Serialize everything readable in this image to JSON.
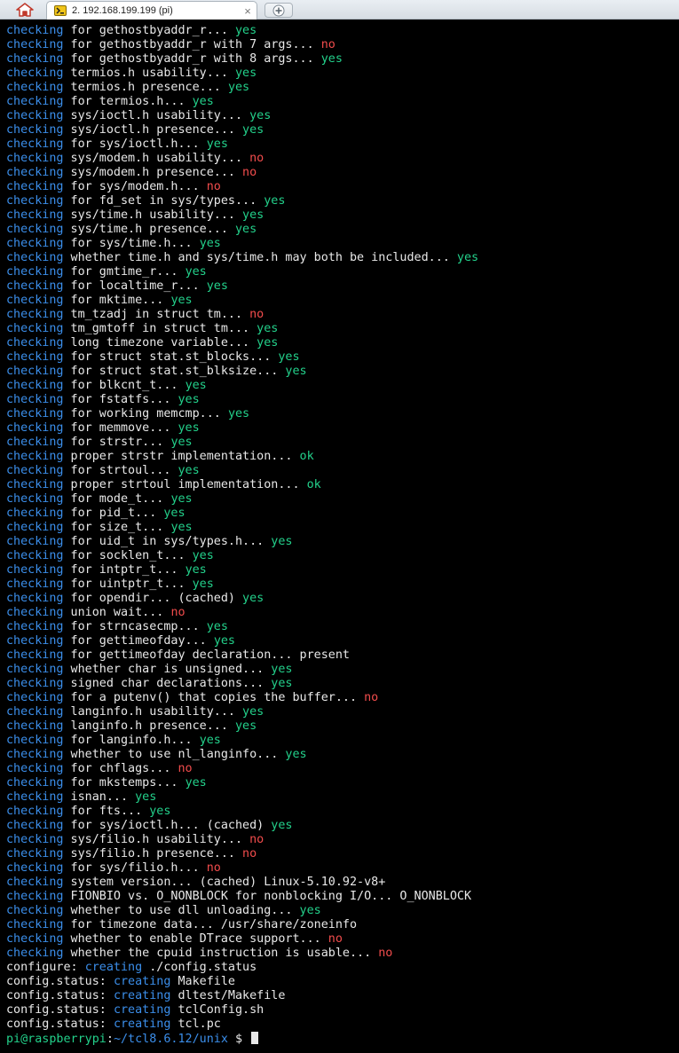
{
  "tab": {
    "title": "2. 192.168.199.199 (pi)",
    "close_label": "×"
  },
  "colors": {
    "keyword": "#3b8eea",
    "yes": "#23d18b",
    "no": "#f14c4c",
    "text": "#e8e8e8",
    "background": "#000000"
  },
  "terminal": {
    "lines": [
      {
        "kw": "checking",
        "text": " for gethostbyaddr_r... ",
        "result": "yes",
        "rtype": "yes"
      },
      {
        "kw": "checking",
        "text": " for gethostbyaddr_r with 7 args... ",
        "result": "no",
        "rtype": "no"
      },
      {
        "kw": "checking",
        "text": " for gethostbyaddr_r with 8 args... ",
        "result": "yes",
        "rtype": "yes"
      },
      {
        "kw": "checking",
        "text": " termios.h usability... ",
        "result": "yes",
        "rtype": "yes"
      },
      {
        "kw": "checking",
        "text": " termios.h presence... ",
        "result": "yes",
        "rtype": "yes"
      },
      {
        "kw": "checking",
        "text": " for termios.h... ",
        "result": "yes",
        "rtype": "yes"
      },
      {
        "kw": "checking",
        "text": " sys/ioctl.h usability... ",
        "result": "yes",
        "rtype": "yes"
      },
      {
        "kw": "checking",
        "text": " sys/ioctl.h presence... ",
        "result": "yes",
        "rtype": "yes"
      },
      {
        "kw": "checking",
        "text": " for sys/ioctl.h... ",
        "result": "yes",
        "rtype": "yes"
      },
      {
        "kw": "checking",
        "text": " sys/modem.h usability... ",
        "result": "no",
        "rtype": "no"
      },
      {
        "kw": "checking",
        "text": " sys/modem.h presence... ",
        "result": "no",
        "rtype": "no"
      },
      {
        "kw": "checking",
        "text": " for sys/modem.h... ",
        "result": "no",
        "rtype": "no"
      },
      {
        "kw": "checking",
        "text": " for fd_set in sys/types... ",
        "result": "yes",
        "rtype": "yes"
      },
      {
        "kw": "checking",
        "text": " sys/time.h usability... ",
        "result": "yes",
        "rtype": "yes"
      },
      {
        "kw": "checking",
        "text": " sys/time.h presence... ",
        "result": "yes",
        "rtype": "yes"
      },
      {
        "kw": "checking",
        "text": " for sys/time.h... ",
        "result": "yes",
        "rtype": "yes"
      },
      {
        "kw": "checking",
        "text": " whether time.h and sys/time.h may both be included... ",
        "result": "yes",
        "rtype": "yes"
      },
      {
        "kw": "checking",
        "text": " for gmtime_r... ",
        "result": "yes",
        "rtype": "yes"
      },
      {
        "kw": "checking",
        "text": " for localtime_r... ",
        "result": "yes",
        "rtype": "yes"
      },
      {
        "kw": "checking",
        "text": " for mktime... ",
        "result": "yes",
        "rtype": "yes"
      },
      {
        "kw": "checking",
        "text": " tm_tzadj in struct tm... ",
        "result": "no",
        "rtype": "no"
      },
      {
        "kw": "checking",
        "text": " tm_gmtoff in struct tm... ",
        "result": "yes",
        "rtype": "yes"
      },
      {
        "kw": "checking",
        "text": " long timezone variable... ",
        "result": "yes",
        "rtype": "yes"
      },
      {
        "kw": "checking",
        "text": " for struct stat.st_blocks... ",
        "result": "yes",
        "rtype": "yes"
      },
      {
        "kw": "checking",
        "text": " for struct stat.st_blksize... ",
        "result": "yes",
        "rtype": "yes"
      },
      {
        "kw": "checking",
        "text": " for blkcnt_t... ",
        "result": "yes",
        "rtype": "yes"
      },
      {
        "kw": "checking",
        "text": " for fstatfs... ",
        "result": "yes",
        "rtype": "yes"
      },
      {
        "kw": "checking",
        "text": " for working memcmp... ",
        "result": "yes",
        "rtype": "yes"
      },
      {
        "kw": "checking",
        "text": " for memmove... ",
        "result": "yes",
        "rtype": "yes"
      },
      {
        "kw": "checking",
        "text": " for strstr... ",
        "result": "yes",
        "rtype": "yes"
      },
      {
        "kw": "checking",
        "text": " proper strstr implementation... ",
        "result": "ok",
        "rtype": "ok"
      },
      {
        "kw": "checking",
        "text": " for strtoul... ",
        "result": "yes",
        "rtype": "yes"
      },
      {
        "kw": "checking",
        "text": " proper strtoul implementation... ",
        "result": "ok",
        "rtype": "ok"
      },
      {
        "kw": "checking",
        "text": " for mode_t... ",
        "result": "yes",
        "rtype": "yes"
      },
      {
        "kw": "checking",
        "text": " for pid_t... ",
        "result": "yes",
        "rtype": "yes"
      },
      {
        "kw": "checking",
        "text": " for size_t... ",
        "result": "yes",
        "rtype": "yes"
      },
      {
        "kw": "checking",
        "text": " for uid_t in sys/types.h... ",
        "result": "yes",
        "rtype": "yes"
      },
      {
        "kw": "checking",
        "text": " for socklen_t... ",
        "result": "yes",
        "rtype": "yes"
      },
      {
        "kw": "checking",
        "text": " for intptr_t... ",
        "result": "yes",
        "rtype": "yes"
      },
      {
        "kw": "checking",
        "text": " for uintptr_t... ",
        "result": "yes",
        "rtype": "yes"
      },
      {
        "kw": "checking",
        "text": " for opendir... (cached) ",
        "result": "yes",
        "rtype": "yes"
      },
      {
        "kw": "checking",
        "text": " union wait... ",
        "result": "no",
        "rtype": "no"
      },
      {
        "kw": "checking",
        "text": " for strncasecmp... ",
        "result": "yes",
        "rtype": "yes"
      },
      {
        "kw": "checking",
        "text": " for gettimeofday... ",
        "result": "yes",
        "rtype": "yes"
      },
      {
        "kw": "checking",
        "text": " for gettimeofday declaration... present",
        "result": "",
        "rtype": "plain"
      },
      {
        "kw": "checking",
        "text": " whether char is unsigned... ",
        "result": "yes",
        "rtype": "yes"
      },
      {
        "kw": "checking",
        "text": " signed char declarations... ",
        "result": "yes",
        "rtype": "yes"
      },
      {
        "kw": "checking",
        "text": " for a putenv() that copies the buffer... ",
        "result": "no",
        "rtype": "no"
      },
      {
        "kw": "checking",
        "text": " langinfo.h usability... ",
        "result": "yes",
        "rtype": "yes"
      },
      {
        "kw": "checking",
        "text": " langinfo.h presence... ",
        "result": "yes",
        "rtype": "yes"
      },
      {
        "kw": "checking",
        "text": " for langinfo.h... ",
        "result": "yes",
        "rtype": "yes"
      },
      {
        "kw": "checking",
        "text": " whether to use nl_langinfo... ",
        "result": "yes",
        "rtype": "yes"
      },
      {
        "kw": "checking",
        "text": " for chflags... ",
        "result": "no",
        "rtype": "no"
      },
      {
        "kw": "checking",
        "text": " for mkstemps... ",
        "result": "yes",
        "rtype": "yes"
      },
      {
        "kw": "checking",
        "text": " isnan... ",
        "result": "yes",
        "rtype": "yes"
      },
      {
        "kw": "checking",
        "text": " for fts... ",
        "result": "yes",
        "rtype": "yes"
      },
      {
        "kw": "checking",
        "text": " for sys/ioctl.h... (cached) ",
        "result": "yes",
        "rtype": "yes"
      },
      {
        "kw": "checking",
        "text": " sys/filio.h usability... ",
        "result": "no",
        "rtype": "no"
      },
      {
        "kw": "checking",
        "text": " sys/filio.h presence... ",
        "result": "no",
        "rtype": "no"
      },
      {
        "kw": "checking",
        "text": " for sys/filio.h... ",
        "result": "no",
        "rtype": "no"
      },
      {
        "kw": "checking",
        "text": " system version... (cached) Linux-5.10.92-v8+",
        "result": "",
        "rtype": "plain"
      },
      {
        "kw": "checking",
        "text": " FIONBIO vs. O_NONBLOCK for nonblocking I/O... O_NONBLOCK",
        "result": "",
        "rtype": "plain"
      },
      {
        "kw": "checking",
        "text": " whether to use dll unloading... ",
        "result": "yes",
        "rtype": "yes"
      },
      {
        "kw": "checking",
        "text": " for timezone data... /usr/share/zoneinfo",
        "result": "",
        "rtype": "plain"
      },
      {
        "kw": "checking",
        "text": " whether to enable DTrace support... ",
        "result": "no",
        "rtype": "no"
      },
      {
        "kw": "checking",
        "text": " whether the cpuid instruction is usable... ",
        "result": "no",
        "rtype": "no"
      }
    ],
    "status_lines": [
      {
        "prefix": "configure: ",
        "kw": "creating",
        "rest": " ./config.status"
      },
      {
        "prefix": "config.status: ",
        "kw": "creating",
        "rest": " Makefile"
      },
      {
        "prefix": "config.status: ",
        "kw": "creating",
        "rest": " dltest/Makefile"
      },
      {
        "prefix": "config.status: ",
        "kw": "creating",
        "rest": " tclConfig.sh"
      },
      {
        "prefix": "config.status: ",
        "kw": "creating",
        "rest": " tcl.pc"
      }
    ],
    "prompt": {
      "user_host": "pi@raspberrypi",
      "sep": ":",
      "path": "~/tcl8.6.12/unix",
      "symbol": " $ "
    }
  }
}
